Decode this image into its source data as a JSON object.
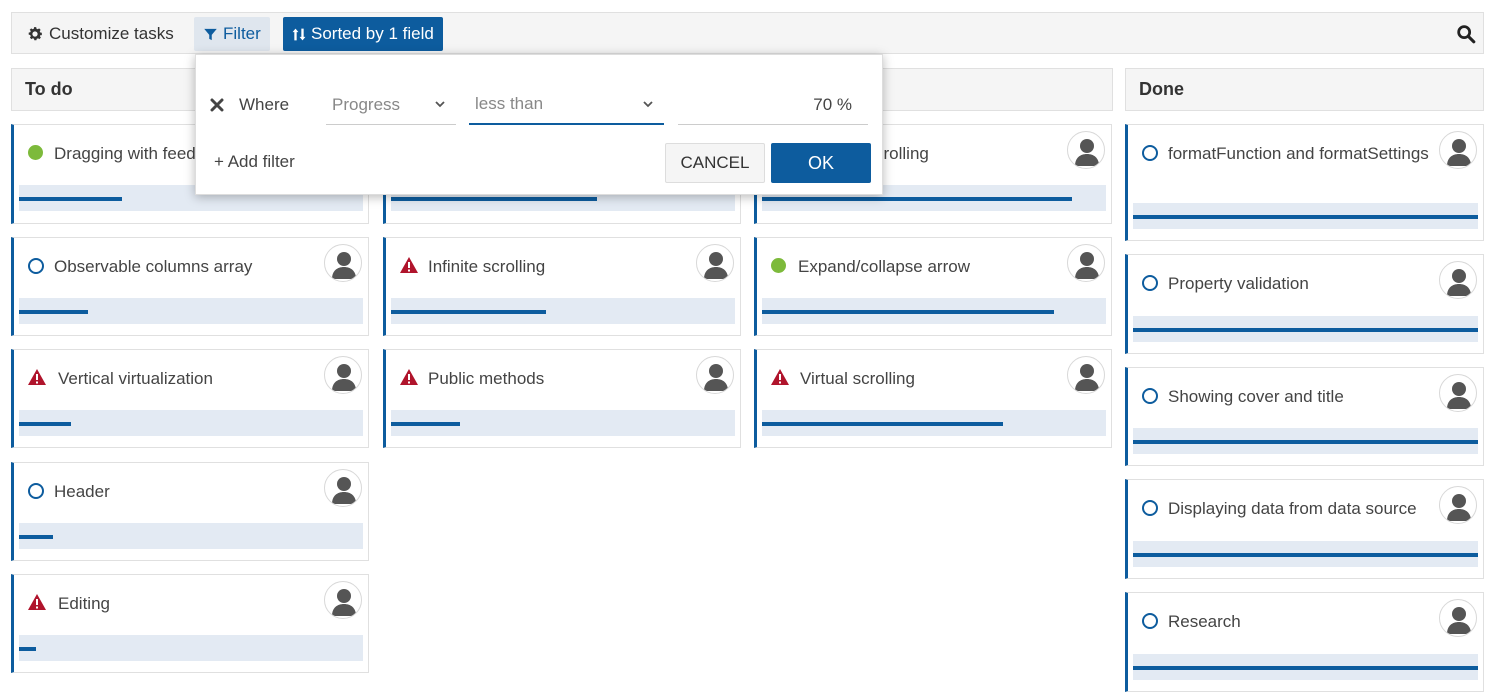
{
  "toolbar": {
    "customize_label": "Customize tasks",
    "filter_label": "Filter",
    "sorted_label": "Sorted by 1 field",
    "icons": [
      "gear-icon",
      "filter-icon",
      "sort-icon",
      "search-icon"
    ]
  },
  "columns": [
    {
      "title": "To do",
      "cards": [
        {
          "title": "Dragging with feedback",
          "status": "done",
          "progress": 30
        },
        {
          "title": "Observable columns array",
          "status": "open",
          "progress": 20
        },
        {
          "title": "Vertical virtualization",
          "status": "warning",
          "progress": 15
        },
        {
          "title": "Header",
          "status": "open",
          "progress": 10
        },
        {
          "title": "Editing",
          "status": "warning",
          "progress": 5
        }
      ]
    },
    {
      "title": "",
      "cards": [
        {
          "title": "",
          "status": "",
          "progress": 60
        },
        {
          "title": "Infinite scrolling",
          "status": "warning",
          "progress": 45
        },
        {
          "title": "Public methods",
          "status": "warning",
          "progress": 20
        }
      ]
    },
    {
      "title": "",
      "cards": [
        {
          "title": "crolling",
          "status": "",
          "progress": 90
        },
        {
          "title": "Expand/collapse arrow",
          "status": "done",
          "progress": 85
        },
        {
          "title": "Virtual scrolling",
          "status": "warning",
          "progress": 70
        }
      ]
    },
    {
      "title": "Done",
      "cards": [
        {
          "title": "formatFunction and formatSettings",
          "status": "open",
          "progress": 100
        },
        {
          "title": "Property validation",
          "status": "open",
          "progress": 100
        },
        {
          "title": "Showing cover and title",
          "status": "open",
          "progress": 100
        },
        {
          "title": "Displaying data from data source",
          "status": "open",
          "progress": 100
        },
        {
          "title": "Research",
          "status": "open",
          "progress": 100
        }
      ]
    }
  ],
  "filter_popup": {
    "where_label": "Where",
    "field_value": "Progress",
    "operator_value": "less than",
    "value": "70 %",
    "add_filter_label": "+ Add filter",
    "cancel_label": "CANCEL",
    "ok_label": "OK"
  },
  "colors": {
    "accent": "#0d5c9e",
    "progress_track": "#e3eaf3",
    "status_done": "#7dba3b",
    "status_warning": "#b0142c"
  }
}
